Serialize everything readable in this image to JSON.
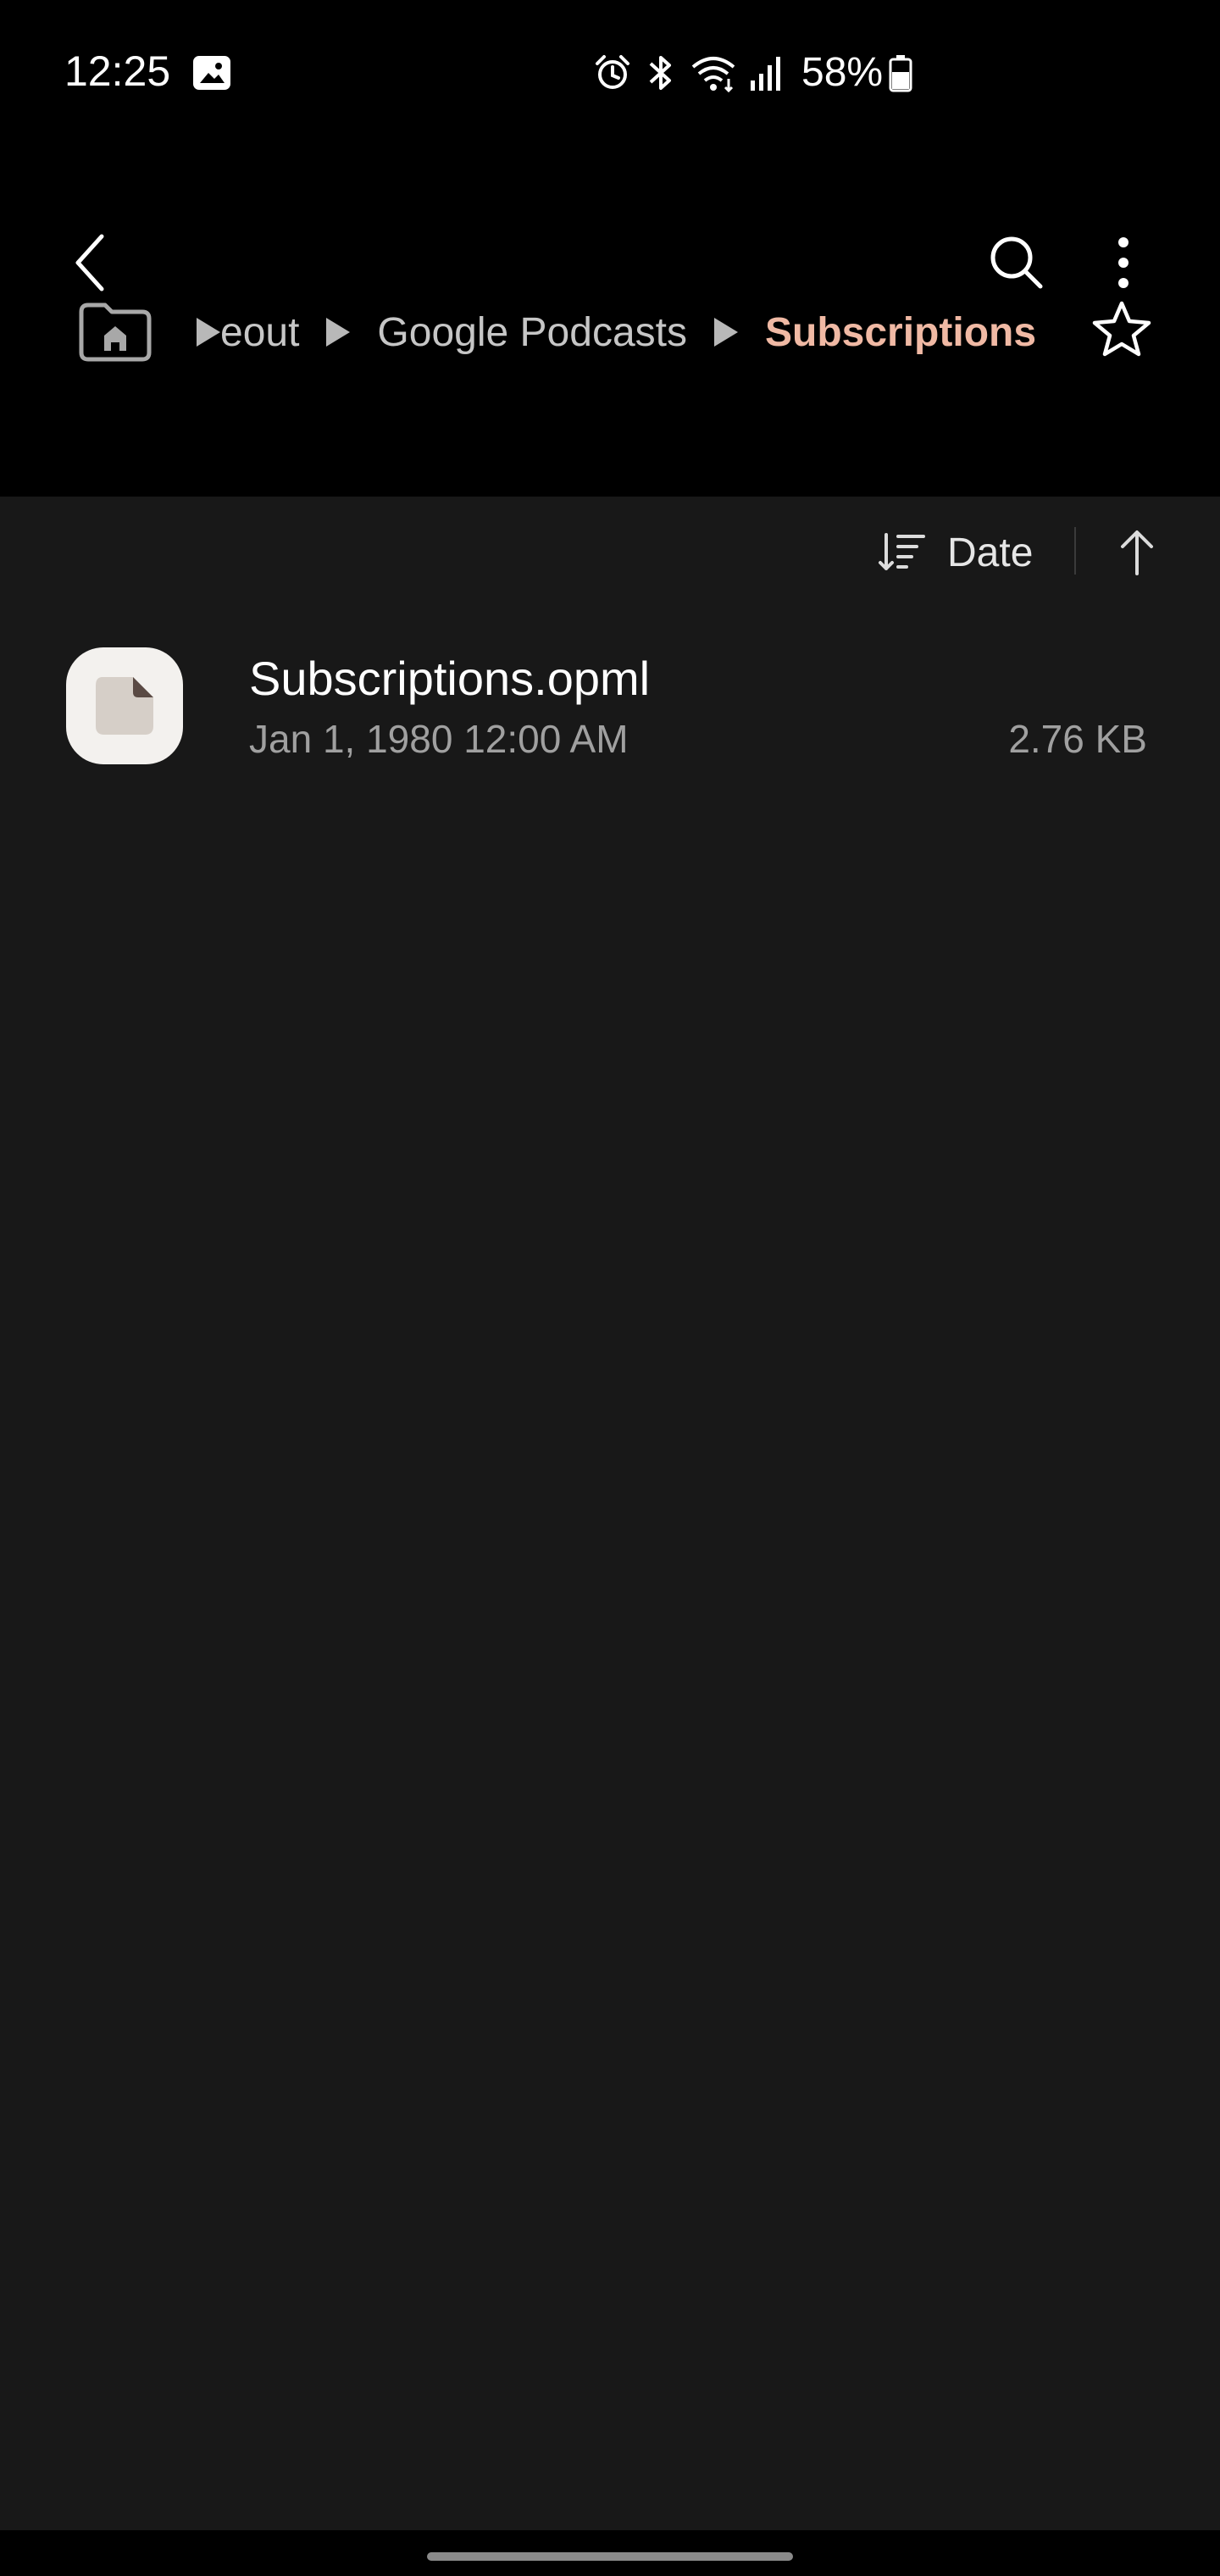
{
  "status_bar": {
    "time": "12:25",
    "battery": "58%",
    "icons": [
      "gallery-icon",
      "alarm-icon",
      "bluetooth-icon",
      "wifi-icon",
      "signal-icon",
      "battery-icon"
    ]
  },
  "app_bar": {
    "back_icon": "chevron-left-icon",
    "search_icon": "search-icon",
    "more_icon": "more-vertical-icon"
  },
  "breadcrumb": {
    "items": [
      "eout",
      "Google Podcasts"
    ],
    "current": "Subscriptions",
    "current_color": "#f0b9a4"
  },
  "sort": {
    "label": "Date",
    "direction_icon": "arrow-up-icon"
  },
  "files": [
    {
      "name": "Subscriptions.opml",
      "date": "Jan 1, 1980 12:00 AM",
      "size": "2.76 KB"
    }
  ],
  "colors": {
    "background": "#181818",
    "header": "#000000",
    "accent": "#f0b9a4"
  }
}
